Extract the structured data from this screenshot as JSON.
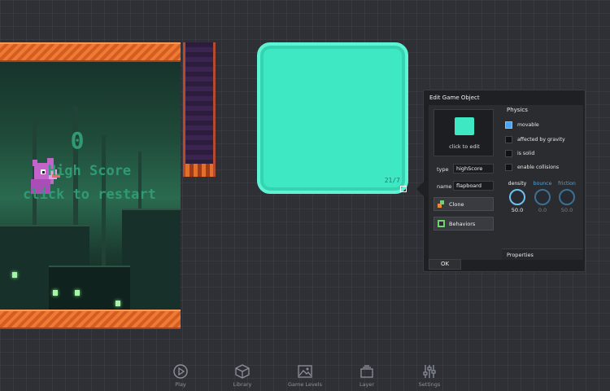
{
  "scene": {
    "score": "0",
    "high_score_text": "High Score",
    "restart_text": "click to restart",
    "colors": {
      "stripe": "#ef7a34",
      "world": "#1f4a39",
      "text": "#2f9a73"
    }
  },
  "selected_object": {
    "size_readout": "21/7",
    "color": "#3de8c2"
  },
  "edit_panel": {
    "title": "Edit Game Object",
    "preview_label": "click to edit",
    "type_label": "type",
    "type_value": "highScore",
    "name_label": "name",
    "name_value": "flapboard",
    "clone_label": "Clone",
    "behaviors_label": "Behaviors",
    "physics": {
      "title": "Physics",
      "options": [
        {
          "label": "movable",
          "checked": true
        },
        {
          "label": "affected by gravity",
          "checked": false
        },
        {
          "label": "is solid",
          "checked": false
        },
        {
          "label": "enable collisions",
          "checked": false
        }
      ],
      "knobs": [
        {
          "label": "density",
          "value": "50.0"
        },
        {
          "label": "bounce",
          "value": "0.0"
        },
        {
          "label": "friction",
          "value": "50.0"
        }
      ]
    },
    "properties_label": "Properties",
    "ok_label": "OK"
  },
  "toolbar": {
    "items": [
      {
        "label": "Play",
        "icon": "play-icon"
      },
      {
        "label": "Library",
        "icon": "cube-icon"
      },
      {
        "label": "Game Levels",
        "icon": "image-icon"
      },
      {
        "label": "Layer",
        "icon": "layers-icon"
      },
      {
        "label": "Settings",
        "icon": "sliders-icon"
      }
    ]
  }
}
